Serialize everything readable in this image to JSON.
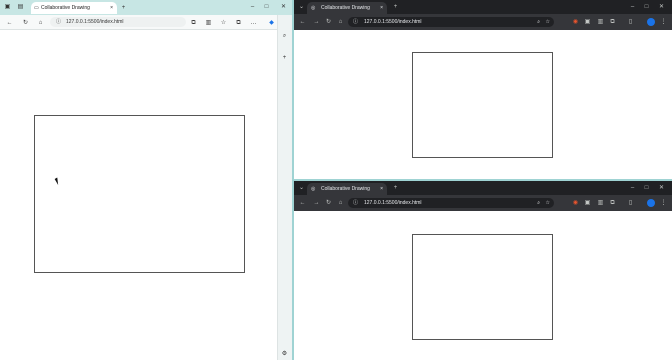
{
  "left_browser": {
    "tab_title": "Collaborative Drawing",
    "url": "127.0.0.1:5500/index.html",
    "tab_close": "×",
    "new_tab": "+"
  },
  "top_right_browser": {
    "tab_title": "Collaborative Drawing",
    "url": "127.0.0.1:5500/index.html",
    "tab_close": "×",
    "new_tab": "+"
  },
  "bottom_right_browser": {
    "tab_title": "Collaborative Drawing",
    "url": "127.0.0.1:5500/index.html",
    "tab_close": "×",
    "new_tab": "+"
  },
  "icons": {
    "back": "←",
    "forward": "→",
    "reload": "↻",
    "home": "⌂",
    "info": "ⓘ",
    "zoom": "⌕",
    "star": "☆",
    "extensions": "⧉",
    "menu": "⋮",
    "more": "…",
    "minimize": "–",
    "maximize": "□",
    "close": "✕",
    "search": "⌕",
    "add": "+",
    "settings": "⚙"
  },
  "colors": {
    "left_tabbar": "#c7e6e4",
    "dark_tabbar": "#202124",
    "dark_toolbar": "#35363a",
    "canvas_border": "#555555"
  }
}
